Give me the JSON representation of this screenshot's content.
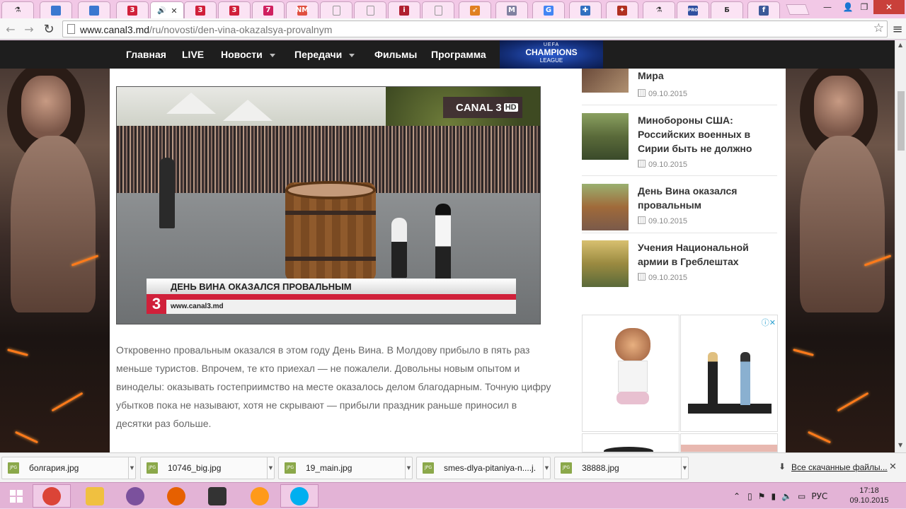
{
  "browser": {
    "tabs": [
      {
        "icon": "flask-icon",
        "color": "#333333",
        "glyph": "⚗"
      },
      {
        "icon": "blue-square-icon",
        "color": "#3a78d0",
        "glyph": ""
      },
      {
        "icon": "blue-square-icon",
        "color": "#3a78d0",
        "glyph": ""
      },
      {
        "icon": "canal3-icon",
        "color": "#d0203a",
        "glyph": "3"
      },
      {
        "icon": "audio-icon",
        "color": "#555555",
        "glyph": "🔊",
        "active": true
      },
      {
        "icon": "canal3-icon",
        "color": "#d0203a",
        "glyph": "3"
      },
      {
        "icon": "canal3-icon",
        "color": "#d0203a",
        "glyph": "3"
      },
      {
        "icon": "seven-icon",
        "color": "#d02060",
        "glyph": "7"
      },
      {
        "icon": "nm-icon",
        "color": "#e05040",
        "glyph": "NM"
      },
      {
        "icon": "document-icon",
        "color": "#bbbbbb",
        "glyph": ""
      },
      {
        "icon": "document-icon",
        "color": "#bbbbbb",
        "glyph": ""
      },
      {
        "icon": "info-icon",
        "color": "#b02030",
        "glyph": "i"
      },
      {
        "icon": "document-icon",
        "color": "#bbbbbb",
        "glyph": ""
      },
      {
        "icon": "arrow-icon",
        "color": "#e08020",
        "glyph": "➶"
      },
      {
        "icon": "m-icon",
        "color": "#8080a0",
        "glyph": "M"
      },
      {
        "icon": "google-icon",
        "color": "#4285f4",
        "glyph": "G"
      },
      {
        "icon": "puzzle-icon",
        "color": "#3070c0",
        "glyph": "✚"
      },
      {
        "icon": "pattern-icon",
        "color": "#b03020",
        "glyph": "✦"
      },
      {
        "icon": "flask-icon",
        "color": "#333333",
        "glyph": "⚗"
      },
      {
        "icon": "pro-icon",
        "color": "#3050a0",
        "glyph": "PRO"
      },
      {
        "icon": "b-icon",
        "color": "#ffffff",
        "glyph": "Б"
      },
      {
        "icon": "facebook-icon",
        "color": "#3b5998",
        "glyph": "f"
      }
    ],
    "address": {
      "domain": "www.canal3.md",
      "path": "/ru/novosti/den-vina-okazalsya-provalnym"
    },
    "tab_close": "✕",
    "win_min": "—",
    "win_max": "❐",
    "win_close": "✕",
    "back": "←",
    "forward": "→",
    "reload": "↻",
    "star": "☆",
    "menu": "≡"
  },
  "site_nav": {
    "items": [
      {
        "label": "Главная",
        "caret": false
      },
      {
        "label": "LIVE",
        "caret": false
      },
      {
        "label": "Новости",
        "caret": true
      },
      {
        "label": "Передачи",
        "caret": true
      },
      {
        "label": "Фильмы",
        "caret": false
      },
      {
        "label": "Программа",
        "caret": false
      }
    ],
    "banner": {
      "line1": "UEFA",
      "line2": "CHAMPIONS",
      "line3": "LEAGUE"
    }
  },
  "article": {
    "video": {
      "channel_logo": "CANAL 3",
      "channel_hd": "HD",
      "headline": "ДЕНЬ ВИНА ОКАЗАЛСЯ ПРОВАЛЬНЫМ",
      "url": "www.canal3.md",
      "number": "3"
    },
    "body": "Откровенно провальным оказался в этом году День Вина. В Молдову прибыло в пять раз меньше туристов. Впрочем, те кто приехал — не пожалели. Довольны новым опытом и виноделы: оказывать гостеприимство на месте оказалось делом благодарным. Точную цифру убытков пока не называют, хотя не скрывают — прибыли праздник раньше приносил в десятки раз больше."
  },
  "sidebar_news": [
    {
      "title": "Мира",
      "date": "09.10.2015"
    },
    {
      "title": "Минобороны США: Российских военных в Сирии быть не должно",
      "date": "09.10.2015"
    },
    {
      "title": "День Вина оказался провальным",
      "date": "09.10.2015"
    },
    {
      "title": "Учения Национальной армии в Греблештах",
      "date": "09.10.2015"
    }
  ],
  "ad": {
    "badge": "ⓘ✕"
  },
  "downloads": {
    "items": [
      {
        "name": "болгария.jpg"
      },
      {
        "name": "10746_big.jpg"
      },
      {
        "name": "19_main.jpg"
      },
      {
        "name": "smes-dlya-pitaniya-n....j..."
      },
      {
        "name": "38888.jpg"
      }
    ],
    "file_badge": "JPG",
    "all_label": "Все скачанные файлы...",
    "download_icon": "⬇",
    "close": "✕"
  },
  "taskbar": {
    "apps": [
      {
        "name": "chrome",
        "color": "#db4437",
        "open": true
      },
      {
        "name": "explorer",
        "color": "#f0c040",
        "open": false
      },
      {
        "name": "viber",
        "color": "#7b519d",
        "open": false
      },
      {
        "name": "firefox",
        "color": "#e66000",
        "open": false
      },
      {
        "name": "camera",
        "color": "#333333",
        "open": false
      },
      {
        "name": "smile",
        "color": "#ff9a1a",
        "open": false
      },
      {
        "name": "skype",
        "color": "#00aff0",
        "open": true
      }
    ],
    "tray": {
      "lang": "РУС",
      "time": "17:18",
      "date": "09.10.2015"
    }
  }
}
